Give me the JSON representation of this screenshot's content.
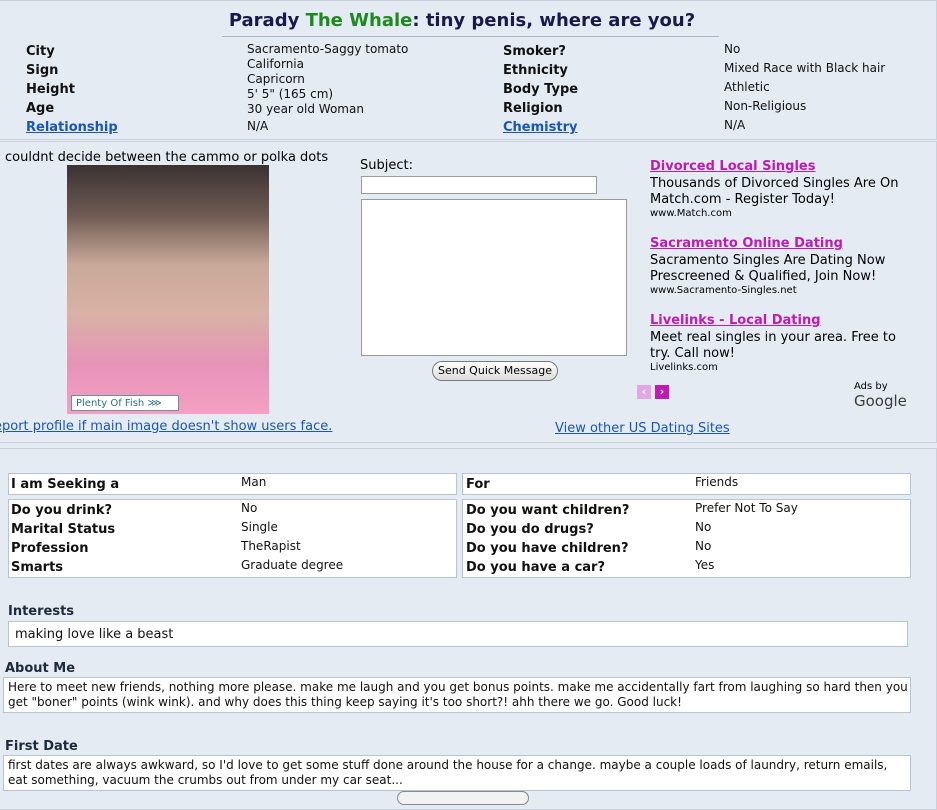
{
  "profile": {
    "title_prefix": "Parady ",
    "title_green": "The Whale",
    "title_suffix": ": tiny penis, where are you?"
  },
  "details_left": [
    {
      "label": "City",
      "value": "Sacramento-Saggy tomato"
    },
    {
      "label": "Sign",
      "value": "California"
    },
    {
      "label": "Height",
      "value": "Capricorn"
    },
    {
      "label": "Age",
      "value": "5' 5\" (165 cm)"
    },
    {
      "label": "Relationship",
      "value": "30 year old Woman"
    }
  ],
  "details_left_extra": "N/A",
  "details_right": [
    {
      "label": "Smoker?",
      "value": "No"
    },
    {
      "label": "Ethnicity",
      "value": "Mixed Race with Black hair"
    },
    {
      "label": "Body Type",
      "value": "Athletic"
    },
    {
      "label": "Religion",
      "value": "Non-Religious"
    },
    {
      "label": "Chemistry",
      "value": "N/A"
    }
  ],
  "photo": {
    "caption": "couldnt decide between the cammo or polka dots",
    "logo_text": "Plenty Of Fish",
    "report_link": "eport profile if main image doesn't show users face."
  },
  "quick_message": {
    "subject_label": "Subject:",
    "send_label": "Send Quick Message"
  },
  "ads": [
    {
      "title": "Divorced Local Singles",
      "body": "Thousands of Divorced Singles Are On Match.com - Register Today!",
      "url": "www.Match.com"
    },
    {
      "title": "Sacramento Online Dating",
      "body": "Sacramento Singles Are Dating Now Prescreened & Qualified, Join Now!",
      "url": "www.Sacramento-Singles.net"
    },
    {
      "title": "Livelinks - Local Dating",
      "body": "Meet real singles in your area. Free to try. Call now!",
      "url": "Livelinks.com"
    }
  ],
  "ads_by_prefix": "Ads by",
  "ads_by_brand": "Google",
  "view_other_link": "View other US Dating Sites",
  "seeking": {
    "label": "I am Seeking a",
    "value": "Man",
    "for_label": "For",
    "for_value": "Friends"
  },
  "habits_left": [
    {
      "label": "Do you drink?",
      "value": "No"
    },
    {
      "label": "Marital Status",
      "value": "Single"
    },
    {
      "label": "Profession",
      "value": "TheRapist"
    },
    {
      "label": "Smarts",
      "value": "Graduate degree"
    }
  ],
  "habits_right": [
    {
      "label": "Do you want children?",
      "value": "Prefer Not To Say"
    },
    {
      "label": "Do you do drugs?",
      "value": "No"
    },
    {
      "label": "Do you have children?",
      "value": "No"
    },
    {
      "label": "Do you have a car?",
      "value": "Yes"
    }
  ],
  "interests": {
    "heading": "Interests",
    "text": "making love like a beast"
  },
  "about": {
    "heading": "About Me",
    "text": "Here to meet new friends, nothing more please. make me laugh and you get bonus points. make me accidentally fart from laughing so hard then you get \"boner\" points (wink wink). and why does this thing keep saying it's too short?! ahh there we go. Good luck!"
  },
  "first_date": {
    "heading": "First Date",
    "text": "first dates are always awkward, so I'd love to get some stuff done around the house for a change. maybe a couple loads of laundry, return emails, eat something, vacuum the crumbs out from under my car seat..."
  }
}
